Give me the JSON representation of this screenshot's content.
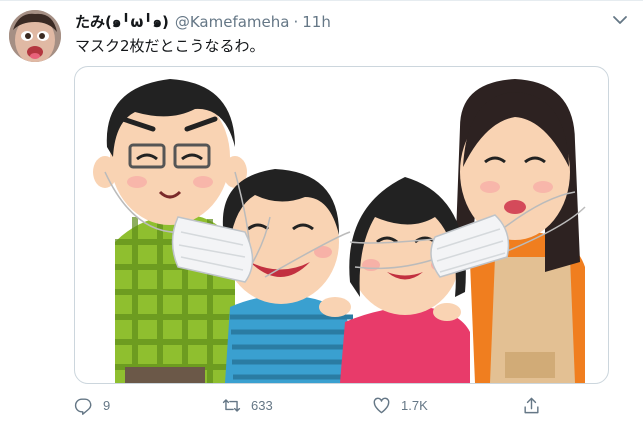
{
  "user": {
    "display_name": "たみ(๑╹ω╹๑)",
    "handle": "@Kamefameha",
    "separator": "·",
    "time": "11h"
  },
  "tweet": {
    "text": "マスク2枚だとこうなるわ。"
  },
  "media": {
    "illustration": "family-of-four-sharing-two-masks"
  },
  "actions": {
    "reply_count": "9",
    "retweet_count": "633",
    "like_count": "1.7K"
  },
  "icons": {
    "more": "chevron-down-icon",
    "reply": "reply-icon",
    "retweet": "retweet-icon",
    "like": "heart-icon",
    "share": "share-icon"
  },
  "colors": {
    "text": "#14171a",
    "secondary": "#657786",
    "border": "#ccd6dd"
  }
}
